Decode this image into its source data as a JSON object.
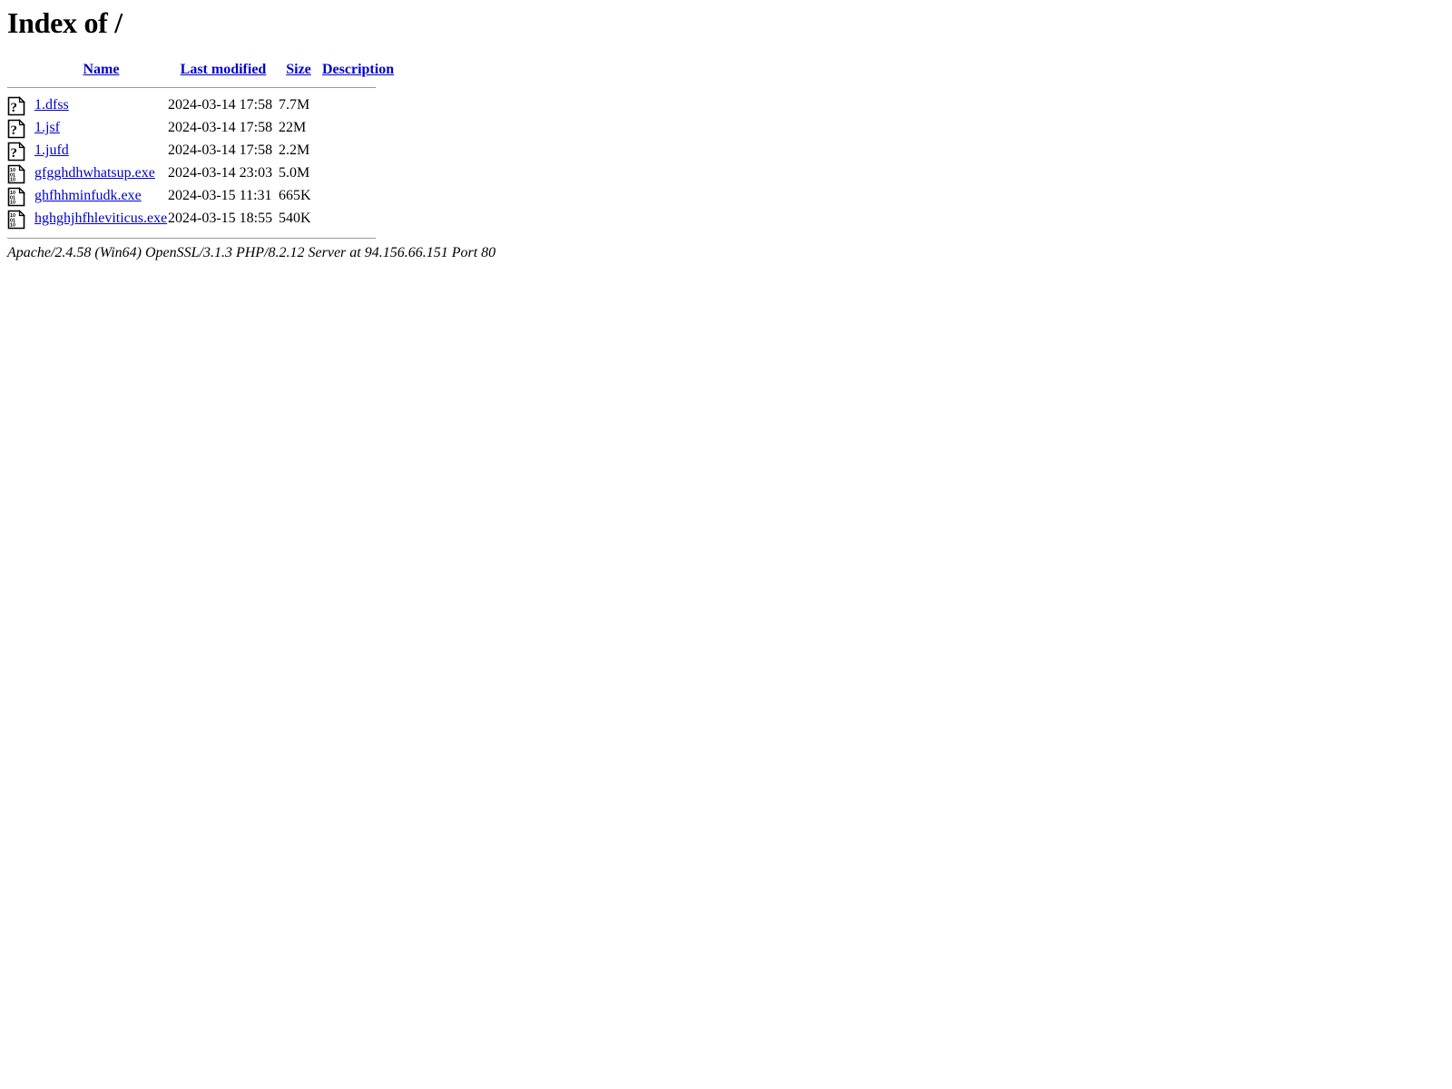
{
  "page": {
    "title": "Index of /",
    "document_title": "Index of /",
    "link_color": "#0000cc",
    "rule_color": "#999999",
    "background_color": "#ffffff",
    "text_color": "#000000"
  },
  "columns": {
    "icon": "",
    "name": "Name",
    "last_modified": "Last modified",
    "size": "Size",
    "description": "Description"
  },
  "files": [
    {
      "icon": "unknown-file-icon",
      "icon_alt": "[   ]",
      "name": "1.dfss",
      "last_modified": "2024-03-14 17:58",
      "size": "7.7M",
      "description": ""
    },
    {
      "icon": "unknown-file-icon",
      "icon_alt": "[   ]",
      "name": "1.jsf",
      "last_modified": "2024-03-14 17:58",
      "size": "22M",
      "description": ""
    },
    {
      "icon": "unknown-file-icon",
      "icon_alt": "[   ]",
      "name": "1.jufd",
      "last_modified": "2024-03-14 17:58",
      "size": "2.2M",
      "description": ""
    },
    {
      "icon": "binary-file-icon",
      "icon_alt": "[   ]",
      "name": "gfgghdhwhatsup.exe",
      "last_modified": "2024-03-14 23:03",
      "size": "5.0M",
      "description": ""
    },
    {
      "icon": "binary-file-icon",
      "icon_alt": "[   ]",
      "name": "ghfhhminfudk.exe",
      "last_modified": "2024-03-15 11:31",
      "size": "665K",
      "description": ""
    },
    {
      "icon": "binary-file-icon",
      "icon_alt": "[   ]",
      "name": "hghghjhfhleviticus.exe",
      "last_modified": "2024-03-15 18:55",
      "size": "540K",
      "description": ""
    }
  ],
  "footer": {
    "signature": "Apache/2.4.58 (Win64) OpenSSL/3.1.3 PHP/8.2.12 Server at 94.156.66.151 Port 80"
  }
}
